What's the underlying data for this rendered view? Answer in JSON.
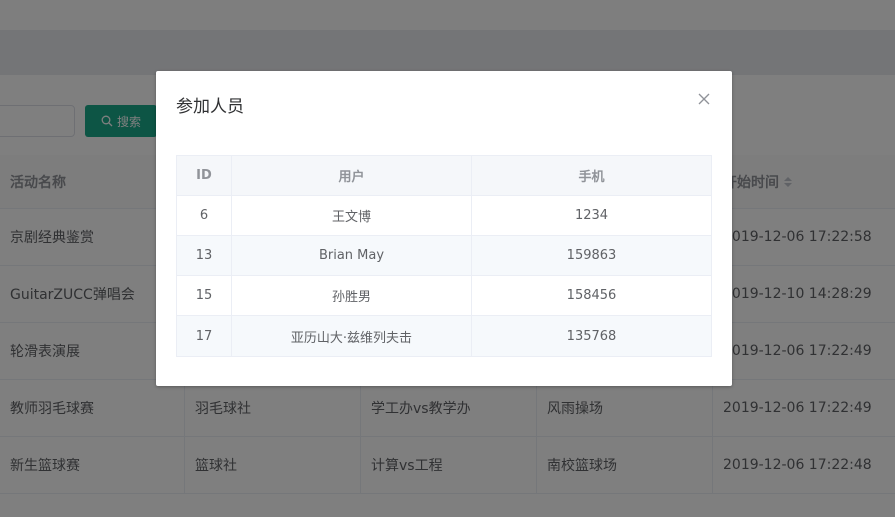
{
  "search": {
    "button_label": "搜索",
    "placeholder": ""
  },
  "bg_table": {
    "columns": [
      "活动名称",
      "",
      "",
      "",
      "开始时间"
    ],
    "rows": [
      [
        "京剧经典鉴赏",
        "",
        "",
        "",
        "2019-12-06 17:22:58"
      ],
      [
        "GuitarZUCC弹唱会",
        "",
        "",
        "",
        "2019-12-10 14:28:29"
      ],
      [
        "轮滑表演展",
        "",
        "",
        "",
        "2019-12-06 17:22:49"
      ],
      [
        "教师羽毛球赛",
        "羽毛球社",
        "学工办vs教学办",
        "风雨操场",
        "2019-12-06 17:22:49"
      ],
      [
        "新生篮球赛",
        "篮球社",
        "计算vs工程",
        "南校篮球场",
        "2019-12-06 17:22:48"
      ]
    ]
  },
  "dialog": {
    "title": "参加人员",
    "table": {
      "columns": [
        "ID",
        "用户",
        "手机"
      ],
      "rows": [
        [
          "6",
          "王文博",
          "1234"
        ],
        [
          "13",
          "Brian May",
          "159863"
        ],
        [
          "15",
          "孙胜男",
          "158456"
        ],
        [
          "17",
          "亚历山大·兹维列夫击",
          "135768"
        ]
      ]
    }
  },
  "colors": {
    "primary": "#1aaa8b",
    "mask": "rgba(0,0,0,0.5)"
  },
  "icons": {
    "search": "search-icon",
    "close": "close-icon",
    "sort": "sort-caret-icon"
  }
}
